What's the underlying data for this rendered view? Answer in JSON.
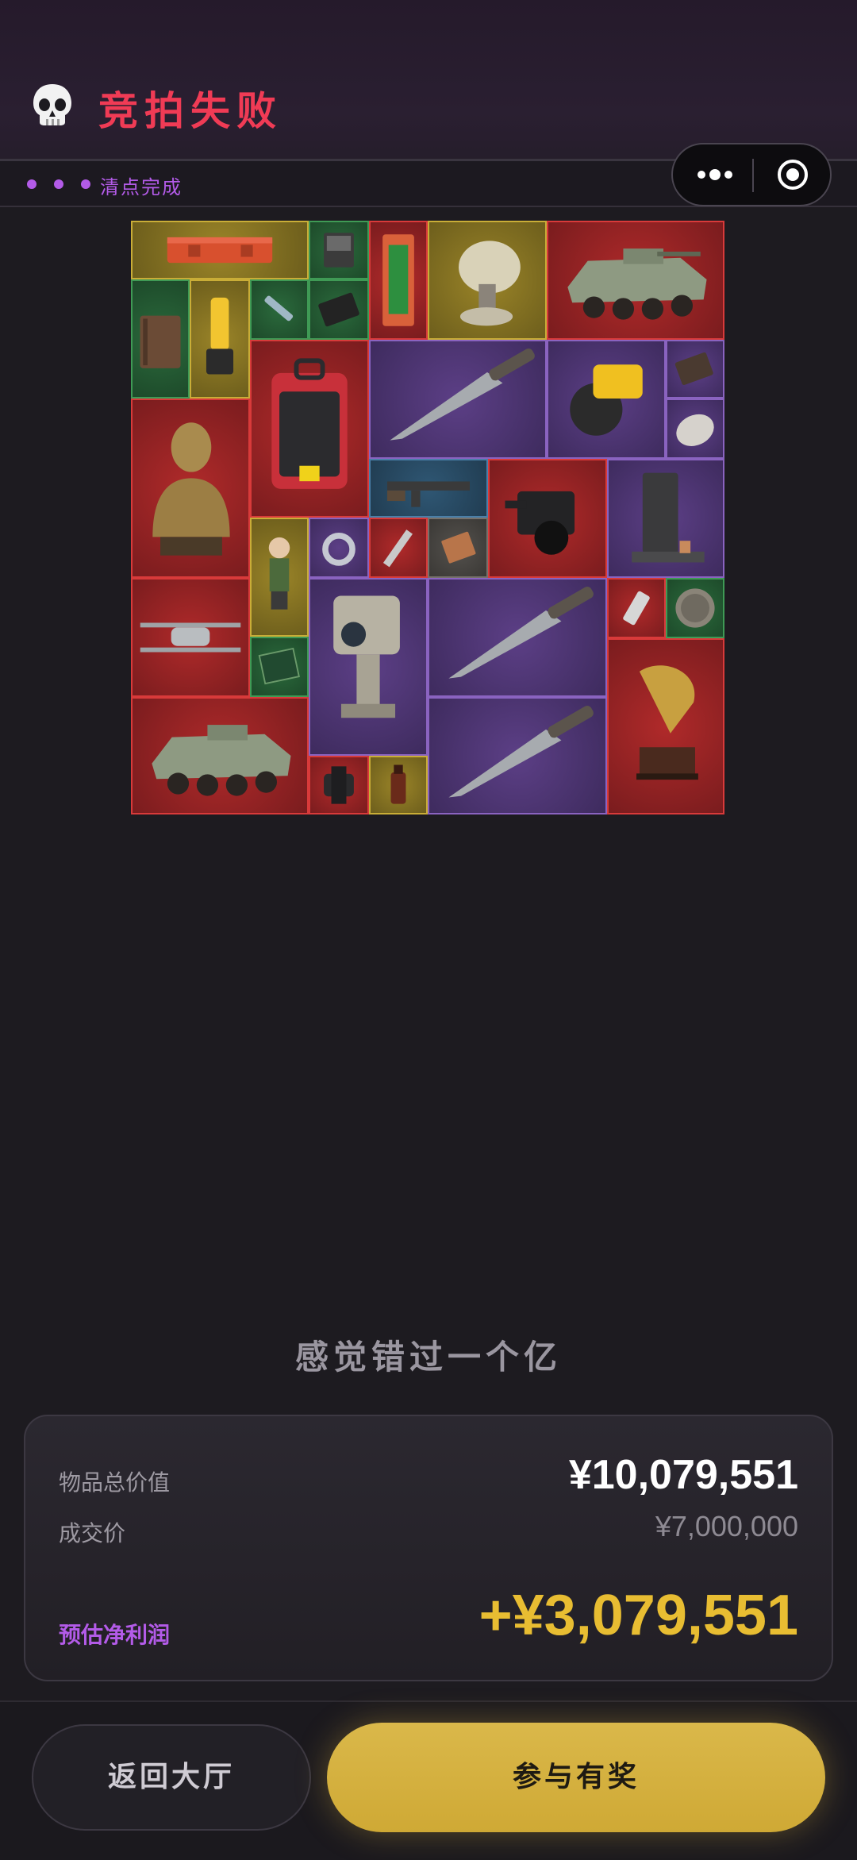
{
  "header": {
    "title": "竞拍失败",
    "skull_icon": "skull-icon",
    "subtitle": "清点完成",
    "menu_icon": "more-dots-icon",
    "close_icon": "target-close-icon"
  },
  "colors": {
    "title": "#f03b55",
    "accent_purple": "#b35be8",
    "profit_gold": "#e8bd32",
    "rarity_yellow": "#c9ad37",
    "rarity_red": "#d83a3a",
    "rarity_purple": "#8a63c0",
    "rarity_green": "#3f9a55",
    "rarity_blue": "#4a7fa8",
    "rarity_gray": "#76716b"
  },
  "items": [
    {
      "icon": "ammo-case-icon",
      "rarity": "yellow"
    },
    {
      "icon": "hard-drive-icon",
      "rarity": "green"
    },
    {
      "icon": "tool-box-icon",
      "rarity": "red"
    },
    {
      "icon": "radar-dish-icon",
      "rarity": "yellow"
    },
    {
      "icon": "armored-vehicle-icon",
      "rarity": "red"
    },
    {
      "icon": "notebook-icon",
      "rarity": "green"
    },
    {
      "icon": "blender-icon",
      "rarity": "yellow"
    },
    {
      "icon": "syringe-icon",
      "rarity": "green"
    },
    {
      "icon": "card-icon",
      "rarity": "green"
    },
    {
      "icon": "defibrillator-icon",
      "rarity": "red"
    },
    {
      "icon": "knife-icon",
      "rarity": "purple"
    },
    {
      "icon": "circular-saw-icon",
      "rarity": "purple"
    },
    {
      "icon": "chip-icon",
      "rarity": "purple"
    },
    {
      "icon": "medal-icon",
      "rarity": "purple"
    },
    {
      "icon": "bust-statue-icon",
      "rarity": "red"
    },
    {
      "icon": "rifle-icon",
      "rarity": "blue"
    },
    {
      "icon": "camera-icon",
      "rarity": "red"
    },
    {
      "icon": "coffee-machine-icon",
      "rarity": "purple"
    },
    {
      "icon": "figurine-icon",
      "rarity": "yellow"
    },
    {
      "icon": "ring-icon",
      "rarity": "purple"
    },
    {
      "icon": "pen-icon",
      "rarity": "red"
    },
    {
      "icon": "matchbox-icon",
      "rarity": "gray"
    },
    {
      "icon": "drone-icon",
      "rarity": "red"
    },
    {
      "icon": "circuit-board-icon",
      "rarity": "green"
    },
    {
      "icon": "thermal-camera-icon",
      "rarity": "purple"
    },
    {
      "icon": "knife-icon",
      "rarity": "purple"
    },
    {
      "icon": "usb-icon",
      "rarity": "red"
    },
    {
      "icon": "coin-icon",
      "rarity": "green"
    },
    {
      "icon": "gramophone-icon",
      "rarity": "red"
    },
    {
      "icon": "armored-vehicle-icon",
      "rarity": "red"
    },
    {
      "icon": "watch-icon",
      "rarity": "red"
    },
    {
      "icon": "bottle-icon",
      "rarity": "yellow"
    },
    {
      "icon": "knife-icon",
      "rarity": "purple"
    }
  ],
  "tagline": "感觉错过一个亿",
  "summary": {
    "total_label": "物品总价值",
    "total_value": "¥10,079,551",
    "deal_label": "成交价",
    "deal_value": "¥7,000,000",
    "profit_label": "预估净利润",
    "profit_value": "+¥3,079,551"
  },
  "buttons": {
    "back_label": "返回大厅",
    "join_label": "参与有奖"
  }
}
